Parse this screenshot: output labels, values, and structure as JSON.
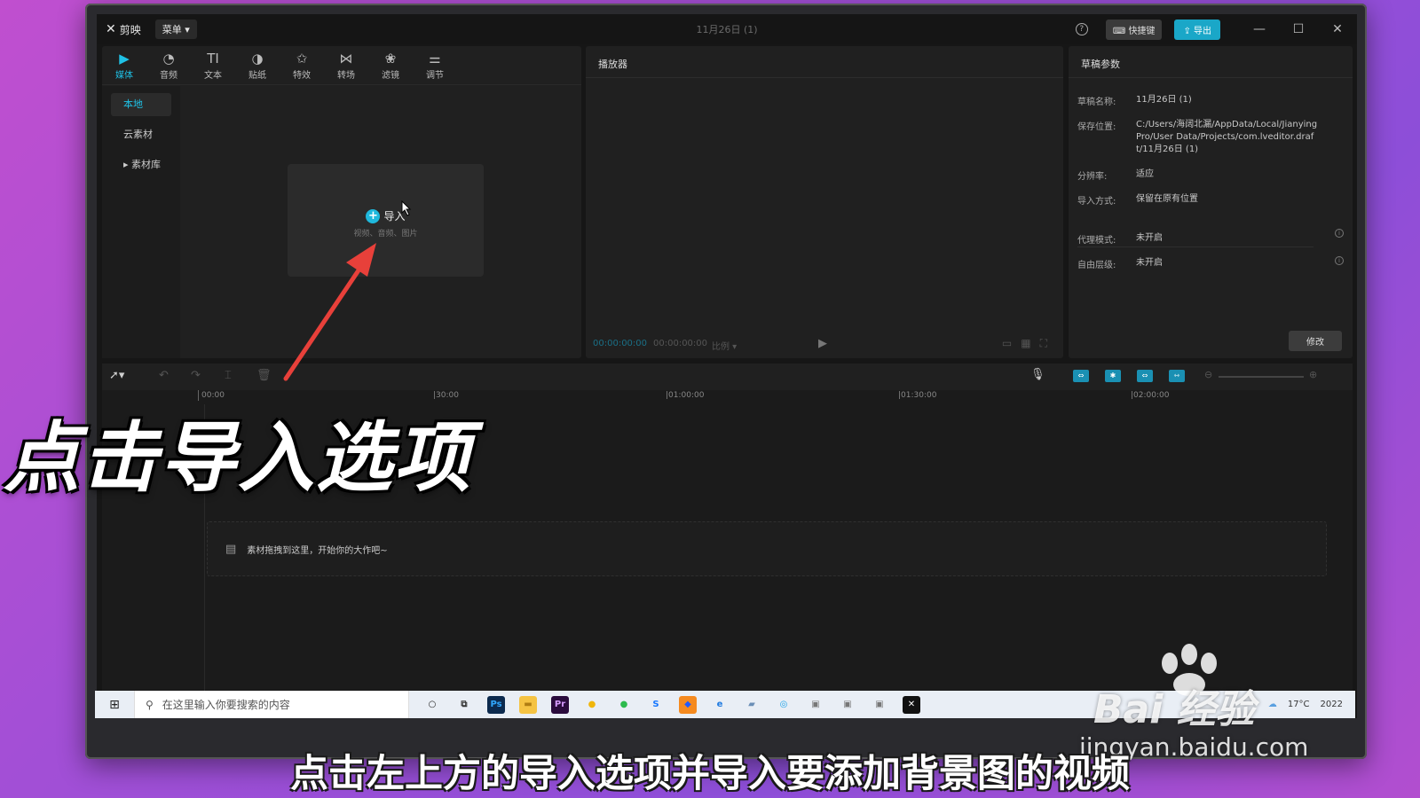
{
  "app": {
    "name": "剪映",
    "menu_label": "菜单",
    "doc_title": "11月26日 (1)",
    "shortcut_label": "快捷键",
    "export_label": "导出"
  },
  "toolbar": {
    "tools": [
      {
        "label": "媒体",
        "icon": "media-icon",
        "glyph": "▶"
      },
      {
        "label": "音频",
        "icon": "audio-icon",
        "glyph": "◔"
      },
      {
        "label": "文本",
        "icon": "text-icon",
        "glyph": "TI"
      },
      {
        "label": "贴纸",
        "icon": "sticker-icon",
        "glyph": "◑"
      },
      {
        "label": "特效",
        "icon": "effects-icon",
        "glyph": "✩"
      },
      {
        "label": "转场",
        "icon": "transition-icon",
        "glyph": "⋈"
      },
      {
        "label": "滤镜",
        "icon": "filter-icon",
        "glyph": "❀"
      },
      {
        "label": "调节",
        "icon": "adjust-icon",
        "glyph": "⚌"
      }
    ]
  },
  "sidebar": {
    "items": [
      {
        "label": "本地"
      },
      {
        "label": "云素材"
      },
      {
        "label": "▸ 素材库"
      }
    ]
  },
  "import": {
    "label": "导入",
    "sub": "视频、音频、图片"
  },
  "player": {
    "title": "播放器",
    "current_time": "00:00:00:00",
    "total_time": "00:00:00:00",
    "ratio": "比例 ▾"
  },
  "draft": {
    "title": "草稿参数",
    "name_key": "草稿名称:",
    "name_val": "11月26日 (1)",
    "path_key": "保存位置:",
    "path_val": "C:/Users/海阔北漏/AppData/Local/JianyingPro/User Data/Projects/com.lveditor.draft/11月26日 (1)",
    "res_key": "分辨率:",
    "res_val": "适应",
    "import_key": "导入方式:",
    "import_val": "保留在原有位置",
    "proxy_key": "代理模式:",
    "proxy_val": "未开启",
    "free_key": "自由层级:",
    "free_val": "未开启",
    "modify_label": "修改"
  },
  "timeline": {
    "ruler": [
      "00:00",
      "|30:00",
      "|01:00:00",
      "|01:30:00",
      "|02:00:00"
    ],
    "drop_hint": "素材拖拽到这里，开始你的大作吧~"
  },
  "taskbar": {
    "search_placeholder": "在这里输入你要搜索的内容",
    "apps": [
      {
        "name": "cortana-icon",
        "glyph": "○",
        "bg": "transparent",
        "fg": "#222"
      },
      {
        "name": "task-view-icon",
        "glyph": "⧉",
        "bg": "transparent",
        "fg": "#333"
      },
      {
        "name": "photoshop-icon",
        "glyph": "Ps",
        "bg": "#0c2a4e",
        "fg": "#31a8ff"
      },
      {
        "name": "file-explorer-icon",
        "glyph": "▬",
        "bg": "#f5c343",
        "fg": "#b07d12"
      },
      {
        "name": "premiere-icon",
        "glyph": "Pr",
        "bg": "#2a0b3d",
        "fg": "#d69bff"
      },
      {
        "name": "browser-360-icon",
        "glyph": "●",
        "bg": "transparent",
        "fg": "#f0b60c"
      },
      {
        "name": "wechat-icon",
        "glyph": "●",
        "bg": "transparent",
        "fg": "#2dbb4e"
      },
      {
        "name": "sogou-icon",
        "glyph": "S",
        "bg": "transparent",
        "fg": "#1677ff"
      },
      {
        "name": "feishu-icon",
        "glyph": "◆",
        "bg": "#f58a1f",
        "fg": "#1f5aff"
      },
      {
        "name": "edge-icon",
        "glyph": "e",
        "bg": "transparent",
        "fg": "#1f7ae0"
      },
      {
        "name": "notepad-icon",
        "glyph": "▰",
        "bg": "transparent",
        "fg": "#6b8fb7"
      },
      {
        "name": "sync-icon",
        "glyph": "◎",
        "bg": "transparent",
        "fg": "#1aa1e8"
      },
      {
        "name": "app-icon-1",
        "glyph": "▣",
        "bg": "transparent",
        "fg": "#777"
      },
      {
        "name": "app-icon-2",
        "glyph": "▣",
        "bg": "transparent",
        "fg": "#777"
      },
      {
        "name": "app-icon-3",
        "glyph": "▣",
        "bg": "transparent",
        "fg": "#777"
      },
      {
        "name": "jianying-taskbar-icon",
        "glyph": "✕",
        "bg": "#111",
        "fg": "#fff"
      }
    ],
    "tray_text": "17°C",
    "date": "2022"
  },
  "overlay": {
    "big_caption": "点击导入选项",
    "sub_caption": "点击左上方的导入选项并导入要添加背景图的视频"
  },
  "watermark": {
    "logo": "Bai 经验",
    "url": "jingyan.baidu.com"
  },
  "colors": {
    "accent": "#1fc1e6",
    "export_bg": "#1aa7c8",
    "arrow": "#e8403a"
  }
}
